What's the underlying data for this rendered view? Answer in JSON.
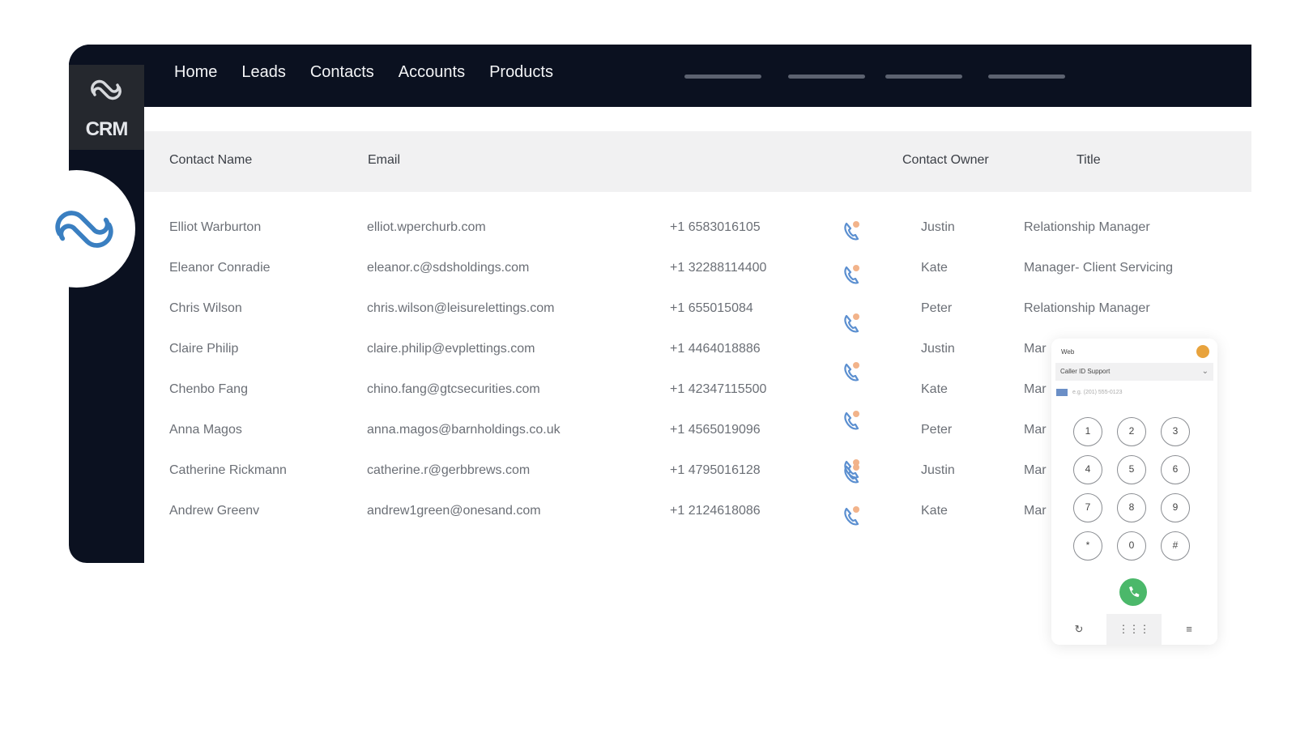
{
  "brand": {
    "name": "CRM"
  },
  "nav": {
    "items": [
      "Home",
      "Leads",
      "Contacts",
      "Accounts",
      "Products"
    ],
    "placeholder_count": 4
  },
  "table": {
    "headers": {
      "name": "Contact Name",
      "email": "Email",
      "owner": "Contact Owner",
      "title": "Title"
    },
    "rows": [
      {
        "name": "Elliot Warburton",
        "email": "elliot.wperchurb.com",
        "phone": "+1 6583016105",
        "owner": "Justin",
        "title": "Relationship Manager"
      },
      {
        "name": "Eleanor Conradie",
        "email": "eleanor.c@sdsholdings.com",
        "phone": "+1 32288114400",
        "owner": "Kate",
        "title": "Manager- Client Servicing"
      },
      {
        "name": "Chris Wilson",
        "email": "chris.wilson@leisurelettings.com",
        "phone": "+1 655015084",
        "owner": "Peter",
        "title": "Relationship Manager"
      },
      {
        "name": "Claire Philip",
        "email": "claire.philip@evplettings.com",
        "phone": "+1 4464018886",
        "owner": "Justin",
        "title": "Mar"
      },
      {
        "name": "Chenbo Fang",
        "email": "chino.fang@gtcsecurities.com",
        "phone": "+1 42347115500",
        "owner": "Kate",
        "title": "Mar"
      },
      {
        "name": "Anna Magos",
        "email": "anna.magos@barnholdings.co.uk",
        "phone": "+1 4565019096",
        "owner": "Peter",
        "title": "Mar"
      },
      {
        "name": "Catherine Rickmann",
        "email": "catherine.r@gerbbrews.com",
        "phone": "+1 4795016128",
        "owner": "Justin",
        "title": "Mar"
      },
      {
        "name": "Andrew Greenv",
        "email": "andrew1green@onesand.com",
        "phone": "+1 2124618086",
        "owner": "Kate",
        "title": "Mar"
      }
    ]
  },
  "dialer": {
    "header": "Web",
    "caller_id": "Caller ID Support",
    "phone_placeholder": "e.g. (201) 555-0123",
    "keys": [
      "1",
      "2",
      "3",
      "4",
      "5",
      "6",
      "7",
      "8",
      "9",
      "*",
      "0",
      "#"
    ],
    "tabs": [
      "recent-icon",
      "keypad-icon",
      "menu-icon"
    ]
  },
  "colors": {
    "nav_bg": "#0b1120",
    "accent_blue": "#3a7fc1",
    "call_green": "#4bb86a"
  }
}
